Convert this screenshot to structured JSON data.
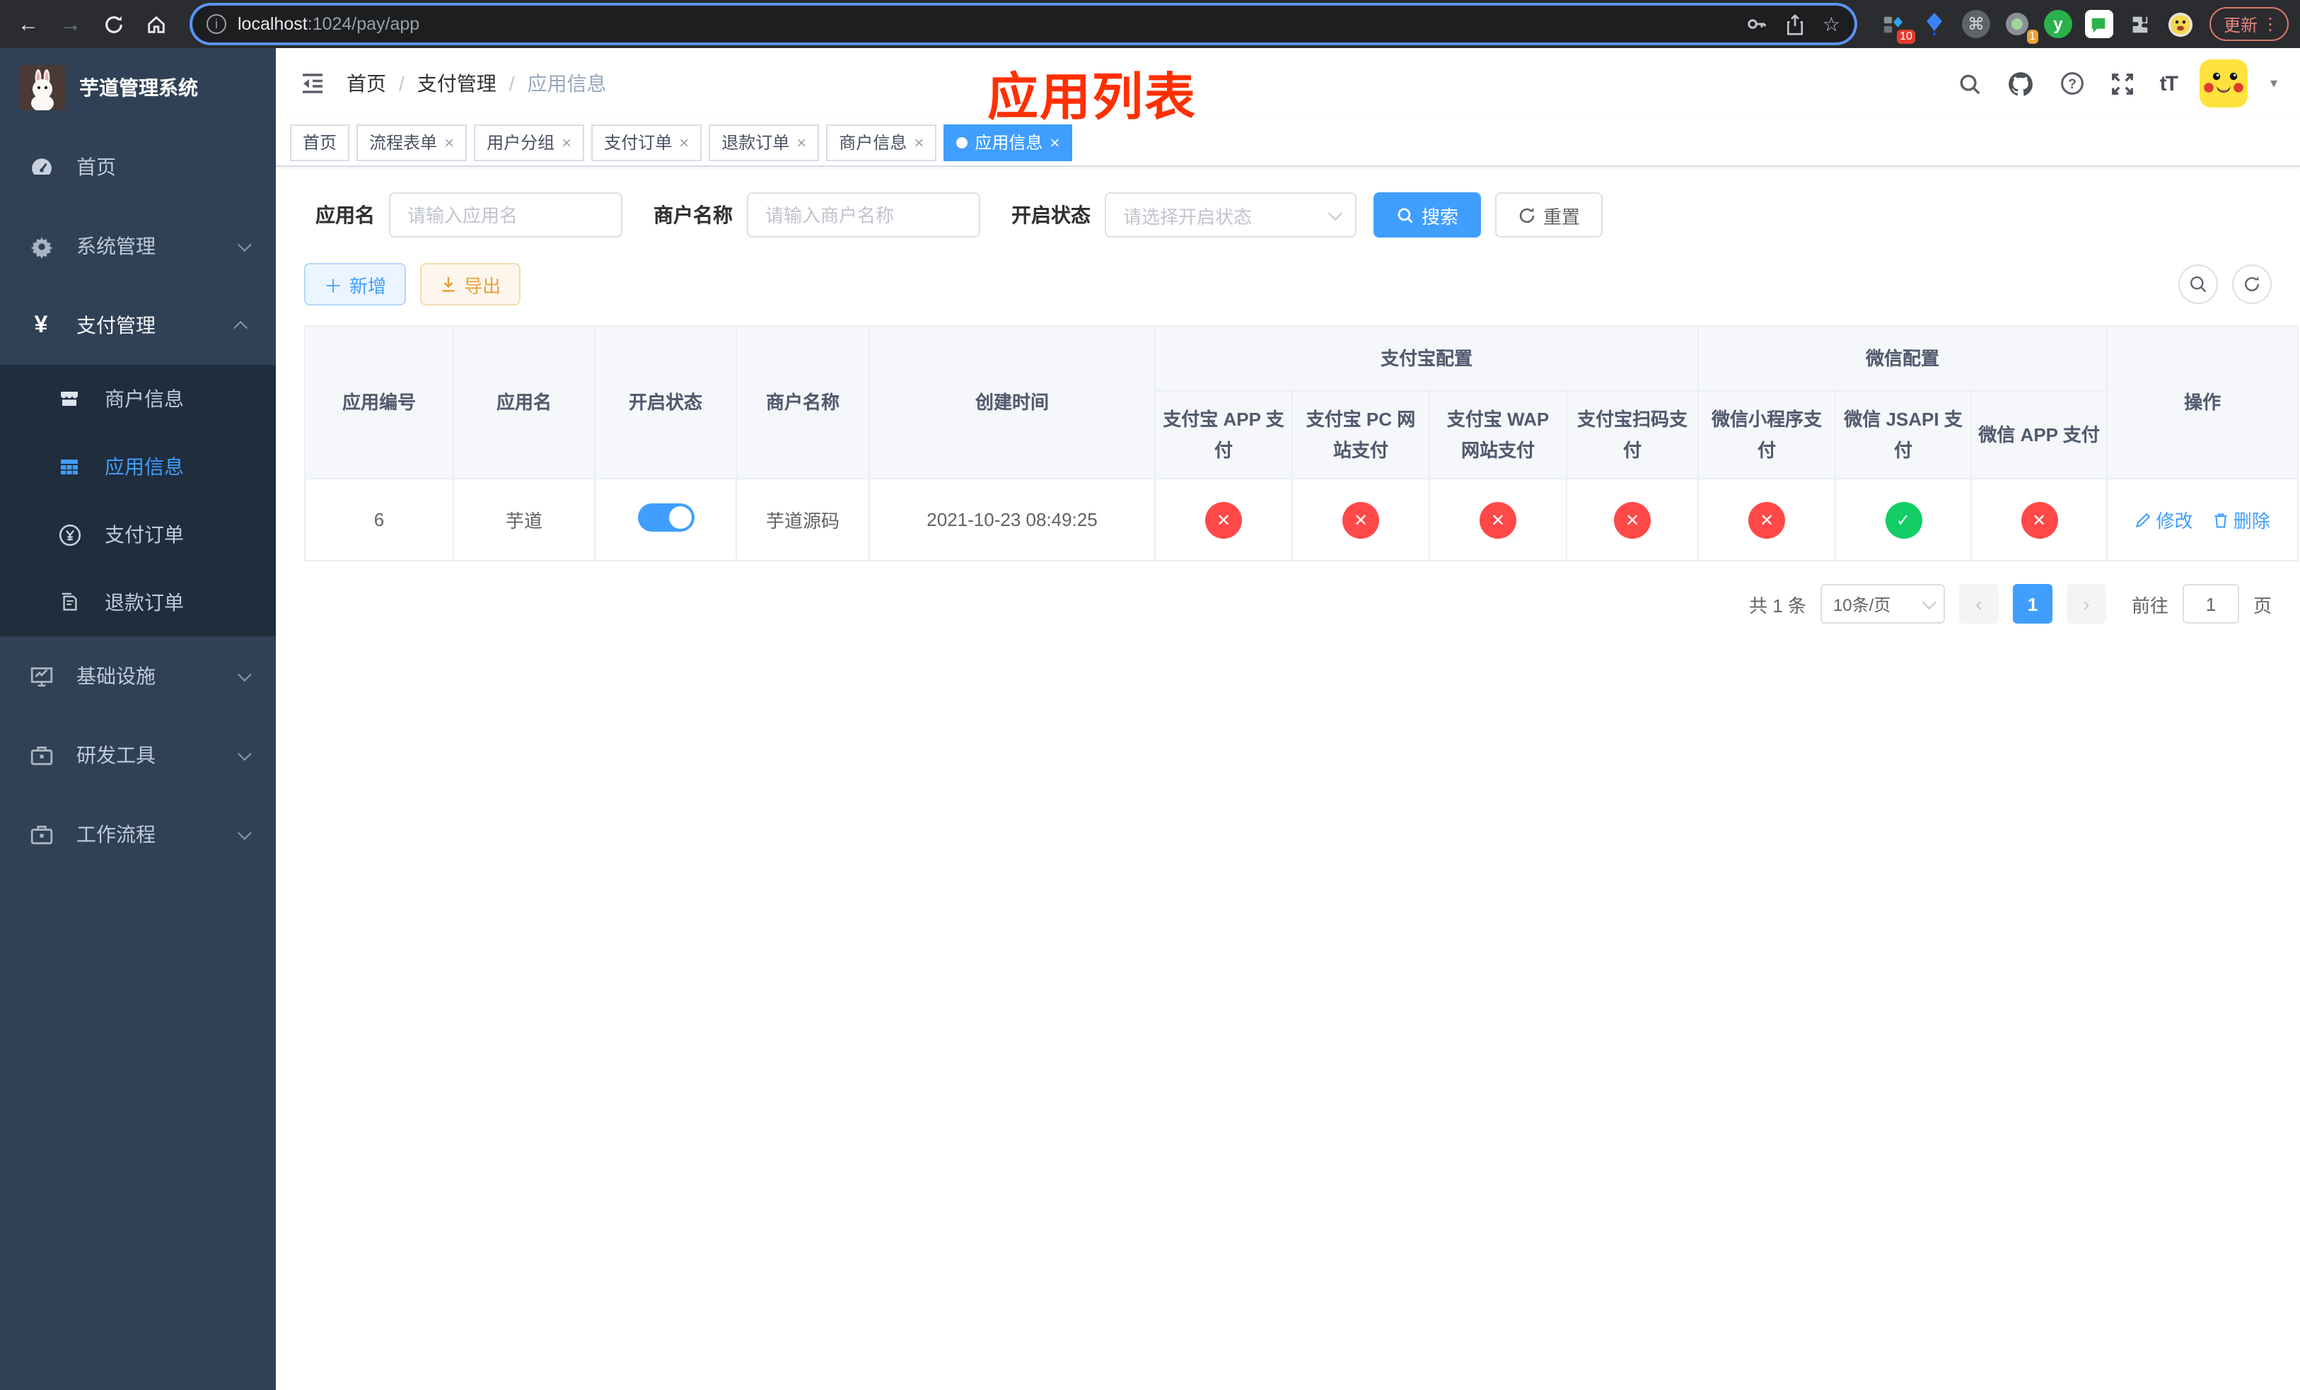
{
  "browser": {
    "url_host": "localhost",
    "url_path": ":1024/pay/app",
    "update_label": "更新",
    "menu_dots": "⋮",
    "extension_badge_a": "10",
    "extension_badge_b": "1",
    "extension_y": "y",
    "star": "☆",
    "back": "←",
    "forward": "→"
  },
  "sidebar": {
    "title": "芋道管理系统",
    "menu": [
      {
        "label": "首页"
      },
      {
        "label": "系统管理"
      },
      {
        "label": "支付管理"
      },
      {
        "label": "基础设施"
      },
      {
        "label": "研发工具"
      },
      {
        "label": "工作流程"
      }
    ],
    "submenu": [
      {
        "label": "商户信息"
      },
      {
        "label": "应用信息"
      },
      {
        "label": "支付订单"
      },
      {
        "label": "退款订单"
      }
    ]
  },
  "navbar": {
    "breadcrumb": [
      {
        "label": "首页"
      },
      {
        "label": "支付管理"
      },
      {
        "label": "应用信息"
      }
    ],
    "separator": "/",
    "font_icon": "tT"
  },
  "tabs": [
    {
      "label": "首页"
    },
    {
      "label": "流程表单"
    },
    {
      "label": "用户分组"
    },
    {
      "label": "支付订单"
    },
    {
      "label": "退款订单"
    },
    {
      "label": "商户信息"
    },
    {
      "label": "应用信息"
    }
  ],
  "page_title": "应用列表",
  "filters": {
    "app_name_label": "应用名",
    "app_name_placeholder": "请输入应用名",
    "merchant_label": "商户名称",
    "merchant_placeholder": "请输入商户名称",
    "status_label": "开启状态",
    "status_placeholder": "请选择开启状态",
    "search": "搜索",
    "reset": "重置"
  },
  "actions": {
    "add": "新增",
    "export": "导出"
  },
  "table": {
    "headers": {
      "app_id": "应用编号",
      "app_name": "应用名",
      "enabled": "开启状态",
      "merchant": "商户名称",
      "created": "创建时间",
      "group_alipay": "支付宝配置",
      "group_wechat": "微信配置",
      "alipay_app": "支付宝 APP 支付",
      "alipay_pc": "支付宝 PC 网站支付",
      "alipay_wap": "支付宝 WAP 网站支付",
      "alipay_qr": "支付宝扫码支付",
      "wx_mini": "微信小程序支付",
      "wx_jsapi": "微信 JSAPI 支付",
      "wx_app": "微信 APP 支付",
      "ops": "操作"
    },
    "row": {
      "app_id": "6",
      "app_name": "芋道",
      "enabled": true,
      "merchant": "芋道源码",
      "created": "2021-10-23 08:49:25",
      "statuses": [
        {
          "state": "fail",
          "glyph": "✕"
        },
        {
          "state": "fail",
          "glyph": "✕"
        },
        {
          "state": "fail",
          "glyph": "✕"
        },
        {
          "state": "fail",
          "glyph": "✕"
        },
        {
          "state": "fail",
          "glyph": "✕"
        },
        {
          "state": "pass",
          "glyph": "✓"
        },
        {
          "state": "fail",
          "glyph": "✕"
        }
      ],
      "edit": "修改",
      "delete": "删除"
    }
  },
  "pagination": {
    "total": "共 1 条",
    "page_size": "10条/页",
    "current_page": "1",
    "prev": "‹",
    "next": "›",
    "goto_label": "前往",
    "goto_value": "1",
    "unit": "页"
  },
  "icons": {
    "close": "×",
    "plus": "＋",
    "caret": "▾",
    "cmd": "⌘",
    "question": "?"
  },
  "colors": {
    "primary": "#409eff",
    "danger": "#ff4949",
    "success": "#13ce66",
    "warning": "#e6a23c",
    "title_red": "#ff2f00",
    "sidebar": "#304156"
  }
}
